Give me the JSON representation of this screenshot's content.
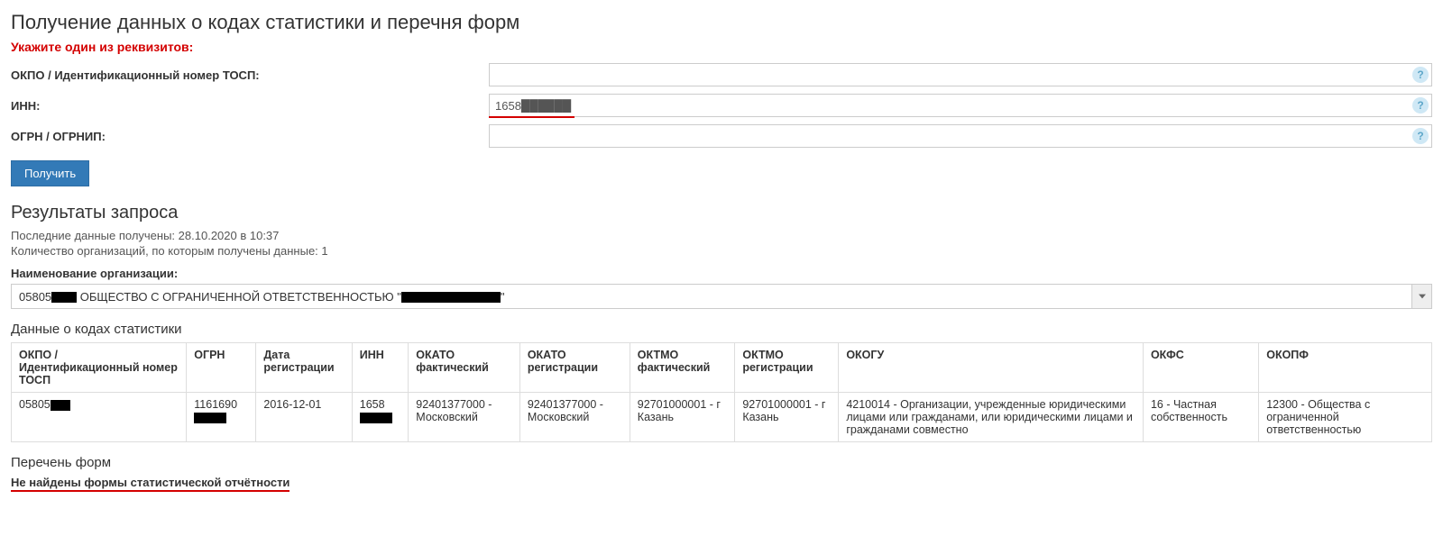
{
  "page": {
    "title": "Получение данных о кодах статистики и перечня форм",
    "instruction": "Укажите один из реквизитов:"
  },
  "form": {
    "okpo": {
      "label": "ОКПО / Идентификационный номер ТОСП:",
      "value": ""
    },
    "inn": {
      "label": "ИНН:",
      "value_prefix": "1658"
    },
    "ogrn": {
      "label": "ОГРН / ОГРНИП:",
      "value": ""
    },
    "submit": "Получить",
    "help": "?"
  },
  "results": {
    "title": "Результаты запроса",
    "last_received_label": "Последние данные получены:",
    "last_received_value": "28.10.2020 в 10:37",
    "count_label": "Количество организаций, по которым получены данные:",
    "count_value": "1",
    "org_label": "Наименование организации:",
    "org_select_prefix": "05805",
    "org_select_middle": " ОБЩЕСТВО С ОГРАНИЧЕННОЙ ОТВЕТСТВЕННОСТЬЮ \"",
    "org_select_suffix": "\""
  },
  "stats": {
    "title": "Данные о кодах статистики",
    "headers": {
      "okpo": "ОКПО / Идентификационный номер ТОСП",
      "ogrn": "ОГРН",
      "reg_date": "Дата регистрации",
      "inn": "ИНН",
      "okato_fact": "ОКАТО фактический",
      "okato_reg": "ОКАТО регистрации",
      "oktmo_fact": "ОКТМО фактический",
      "oktmo_reg": "ОКТМО регистрации",
      "okogu": "ОКОГУ",
      "okfs": "ОКФС",
      "okopf": "ОКОПФ"
    },
    "row": {
      "okpo_prefix": "05805",
      "ogrn_prefix": "1161690",
      "reg_date": "2016-12-01",
      "inn_prefix": "1658",
      "okato_fact": "92401377000 - Московский",
      "okato_reg": "92401377000 - Московский",
      "oktmo_fact": "92701000001 - г Казань",
      "oktmo_reg": "92701000001 - г Казань",
      "okogu": "4210014 - Организации, учрежденные юридическими лицами или гражданами, или юридическими лицами и гражданами совместно",
      "okfs": "16 - Частная собственность",
      "okopf": "12300 - Общества с ограниченной ответственностью"
    }
  },
  "forms": {
    "title": "Перечень форм",
    "not_found": "Не найдены формы статистической отчётности"
  }
}
